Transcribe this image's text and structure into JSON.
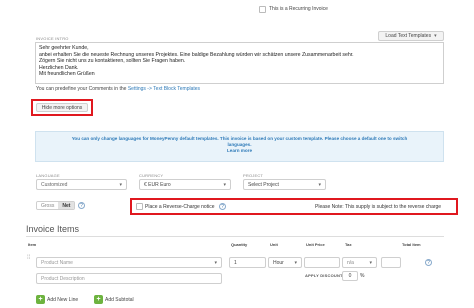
{
  "recurring": {
    "label": "This is a Recurring Invoice"
  },
  "intro": {
    "label": "Invoice Intro",
    "load_templates": "Load Text Templates",
    "lines": [
      "Sehr geehrter Kunde,",
      "anbei erhalten Sie die neueste Rechnung unseres Projektes. Eine baldige Bezahlung würden wir schätzen unsere Zusammenarbeit sehr.",
      "Zögern Sie nicht uns zu kontaktieren, sollten Sie Fragen haben.",
      "Herzlichen Dank.",
      "Mit freundlichen Grüßen"
    ],
    "predefine_text": "You can predefine your Comments in the",
    "predefine_link": "Settings -> Text Block Templates"
  },
  "hide_options": {
    "label": "Hide more options"
  },
  "notice": {
    "text": "You can only change languages for MoneyPenny default templates. This invoice is based on your custom template. Please choose a default one to switch languages.",
    "link": "Learn more"
  },
  "selectors": {
    "language": {
      "label": "Language",
      "value": "Customized"
    },
    "currency": {
      "label": "Currency",
      "value": "€ EUR Euro"
    },
    "project": {
      "label": "Project",
      "value": "Select Project"
    }
  },
  "gross_net": {
    "gross": "Gross",
    "net": "Net"
  },
  "reverse_charge": {
    "label": "Place a Reverse-Charge notice",
    "note": "Please Note: This supply is subject to the reverse charge"
  },
  "items": {
    "title": "Invoice Items",
    "headers": {
      "item": "Item",
      "quantity": "Quantity",
      "unit": "Unit",
      "unit_price": "Unit Price",
      "tax": "Tax",
      "total": "Total Item"
    },
    "row": {
      "product_placeholder": "Product Name",
      "description_placeholder": "Product Description",
      "quantity": "1",
      "unit": "Hour",
      "tax": "n/a",
      "discount_label": "Apply Discount",
      "discount_value": "0",
      "discount_unit": "%"
    },
    "add_line": "Add New Line",
    "add_subtotal": "Add Subtotal"
  },
  "colors": {
    "accent_red": "#e0181f",
    "link_blue": "#2e7ab8",
    "green": "#6db33f"
  }
}
